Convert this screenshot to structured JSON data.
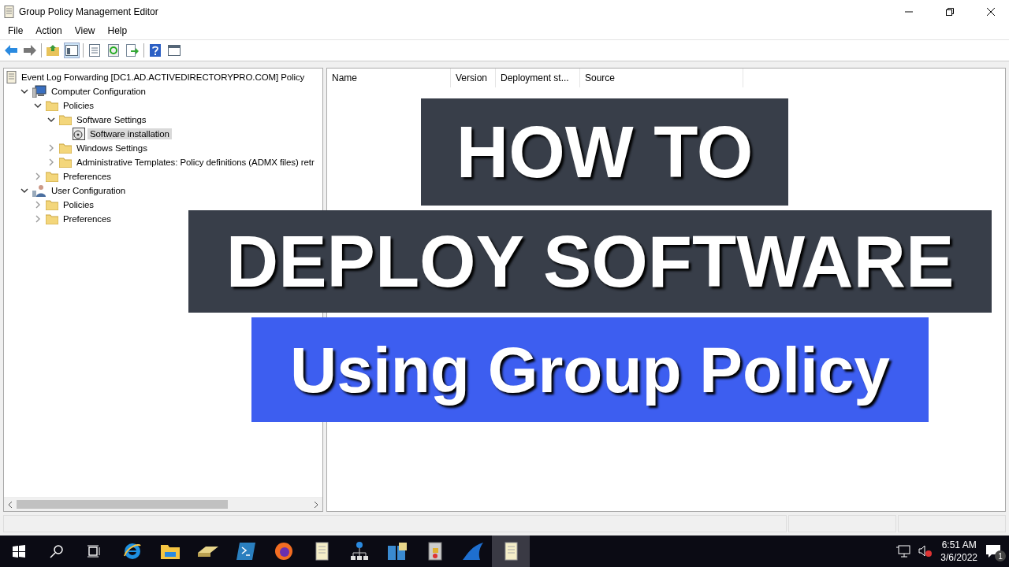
{
  "window": {
    "title": "Group Policy Management Editor"
  },
  "menu": [
    "File",
    "Action",
    "View",
    "Help"
  ],
  "toolbar": [
    {
      "kind": "back",
      "pressed": false
    },
    {
      "kind": "forward",
      "pressed": false
    },
    {
      "kind": "sep"
    },
    {
      "kind": "up",
      "pressed": false
    },
    {
      "kind": "tree",
      "pressed": true
    },
    {
      "kind": "sep"
    },
    {
      "kind": "list",
      "pressed": false
    },
    {
      "kind": "refresh",
      "pressed": false
    },
    {
      "kind": "export",
      "pressed": false
    },
    {
      "kind": "sep"
    },
    {
      "kind": "help",
      "pressed": false
    },
    {
      "kind": "view",
      "pressed": false
    }
  ],
  "tree": [
    {
      "label": "Event Log Forwarding [DC1.AD.ACTIVEDIRECTORYPRO.COM] Policy",
      "kind": "policy",
      "selected": false,
      "children": [
        {
          "label": "Computer Configuration",
          "kind": "computer",
          "expanded": true,
          "selected": false,
          "children": [
            {
              "label": "Policies",
              "kind": "folder",
              "expanded": true,
              "selected": false,
              "children": [
                {
                  "label": "Software Settings",
                  "kind": "folder",
                  "expanded": true,
                  "selected": false,
                  "children": [
                    {
                      "label": "Software installation",
                      "kind": "software",
                      "selected": true
                    }
                  ]
                },
                {
                  "label": "Windows Settings",
                  "kind": "folder",
                  "expanded": false,
                  "selected": false
                },
                {
                  "label": "Administrative Templates: Policy definitions (ADMX files) retr",
                  "kind": "folder",
                  "expanded": false,
                  "selected": false
                }
              ]
            },
            {
              "label": "Preferences",
              "kind": "folder",
              "expanded": false,
              "selected": false
            }
          ]
        },
        {
          "label": "User Configuration",
          "kind": "user",
          "expanded": true,
          "selected": false,
          "children": [
            {
              "label": "Policies",
              "kind": "folder",
              "expanded": false,
              "selected": false
            },
            {
              "label": "Preferences",
              "kind": "folder",
              "expanded": false,
              "selected": false
            }
          ]
        }
      ]
    }
  ],
  "table": {
    "columns": [
      "Name",
      "Version",
      "Deployment st...",
      "Source"
    ]
  },
  "banners": [
    {
      "text": "HOW TO",
      "kind": "dark"
    },
    {
      "text": "DEPLOY SOFTWARE",
      "kind": "dark"
    },
    {
      "text": "Using Group Policy",
      "kind": "blue"
    }
  ],
  "taskbar": {
    "apps": [
      {
        "kind": "start",
        "active": false
      },
      {
        "kind": "search",
        "active": false
      },
      {
        "kind": "taskview",
        "active": false
      },
      {
        "kind": "browser",
        "active": false
      },
      {
        "kind": "explorer",
        "active": false
      },
      {
        "kind": "drive",
        "active": false
      },
      {
        "kind": "shell",
        "active": false
      },
      {
        "kind": "firefox",
        "active": false
      },
      {
        "kind": "scroll",
        "active": false
      },
      {
        "kind": "network",
        "active": false
      },
      {
        "kind": "server",
        "active": false
      },
      {
        "kind": "lock",
        "active": false
      },
      {
        "kind": "shark",
        "active": false
      },
      {
        "kind": "scroll",
        "active": true
      }
    ],
    "time": "6:51 AM",
    "date": "3/6/2022",
    "notifications": "1"
  }
}
